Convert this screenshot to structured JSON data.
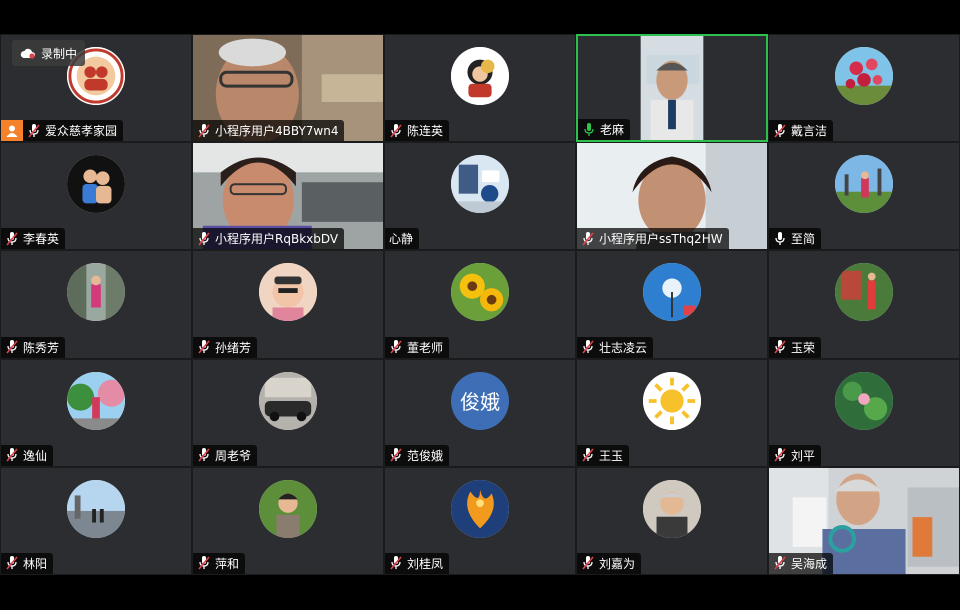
{
  "recording": {
    "label": "录制中"
  },
  "participants": [
    {
      "name": "爱众慈孝家园",
      "type": "avatar",
      "muted": true,
      "host": true,
      "art": "logo"
    },
    {
      "name": "小程序用户4BBY7wn4",
      "type": "video",
      "muted": true,
      "art": "man1"
    },
    {
      "name": "陈连英",
      "type": "avatar",
      "muted": true,
      "art": "woman_round"
    },
    {
      "name": "老麻",
      "type": "video",
      "muted": false,
      "active": true,
      "art": "man2"
    },
    {
      "name": "戴言洁",
      "type": "avatar",
      "muted": true,
      "art": "flowers_red"
    },
    {
      "name": "李春英",
      "type": "avatar",
      "muted": true,
      "art": "kids"
    },
    {
      "name": "小程序用户RqBkxbDV",
      "type": "video",
      "muted": true,
      "art": "woman1"
    },
    {
      "name": "心静",
      "type": "avatar",
      "muted": false,
      "nomic": true,
      "art": "room"
    },
    {
      "name": "小程序用户ssThq2HW",
      "type": "video",
      "muted": true,
      "art": "woman2"
    },
    {
      "name": "至简",
      "type": "avatar",
      "muted": false,
      "art": "park"
    },
    {
      "name": "陈秀芳",
      "type": "avatar",
      "muted": true,
      "art": "street"
    },
    {
      "name": "孙绪芳",
      "type": "avatar",
      "muted": true,
      "art": "selfie"
    },
    {
      "name": "董老师",
      "type": "avatar",
      "muted": true,
      "art": "sunflower"
    },
    {
      "name": "壮志凌云",
      "type": "avatar",
      "muted": true,
      "art": "sky"
    },
    {
      "name": "玉荣",
      "type": "avatar",
      "muted": true,
      "art": "garden"
    },
    {
      "name": "逸仙",
      "type": "avatar",
      "muted": true,
      "art": "trees"
    },
    {
      "name": "周老爷",
      "type": "avatar",
      "muted": true,
      "art": "car"
    },
    {
      "name": "范俊娥",
      "type": "avatar",
      "muted": true,
      "art": "text",
      "avatar_text": "俊娥"
    },
    {
      "name": "王玉",
      "type": "avatar",
      "muted": true,
      "art": "sun"
    },
    {
      "name": "刘平",
      "type": "avatar",
      "muted": true,
      "art": "lotus"
    },
    {
      "name": "林阳",
      "type": "avatar",
      "muted": true,
      "art": "plaza"
    },
    {
      "name": "萍和",
      "type": "avatar",
      "muted": true,
      "art": "woman_garden"
    },
    {
      "name": "刘桂凤",
      "type": "avatar",
      "muted": true,
      "art": "phoenix"
    },
    {
      "name": "刘嘉为",
      "type": "avatar",
      "muted": true,
      "art": "oldman"
    },
    {
      "name": "吴海成",
      "type": "video",
      "muted": true,
      "art": "man3"
    }
  ],
  "colors": {
    "tile": "#2b2d30",
    "active_border": "#2fbf4f",
    "host_badge": "#f5822a",
    "muted_red": "#e0424a",
    "mic_green": "#31c24a",
    "avatar_text_bg": "#3e6fb6"
  }
}
